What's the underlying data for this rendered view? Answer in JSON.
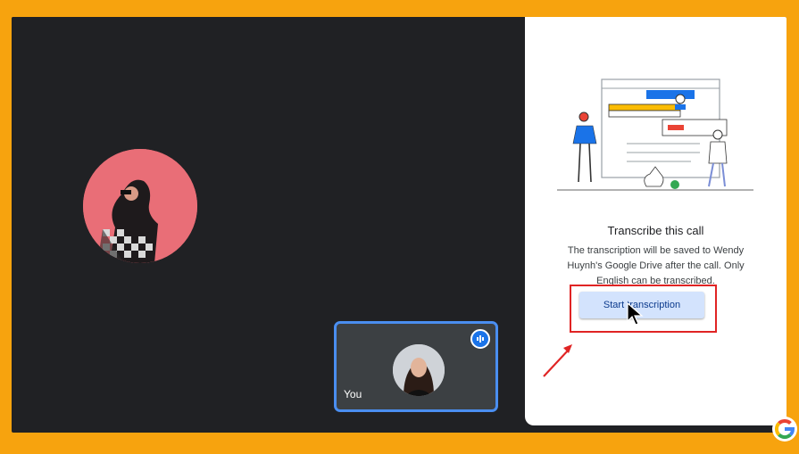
{
  "self_tile": {
    "label": "You"
  },
  "transcribe_panel": {
    "title": "Transcribe this call",
    "description": "The transcription will be saved to Wendy Huynh's Google Drive after the call. Only English can be transcribed.",
    "start_button_label": "Start transcription"
  },
  "colors": {
    "outer_border": "#f7a30e",
    "call_background": "#202124",
    "highlight": "#e02424",
    "button_fill": "#d3e3fd",
    "tile_border": "#4a8ef0"
  },
  "icons": {
    "audio": "audio-level-icon",
    "cursor": "mouse-pointer-icon",
    "annotation": "red-arrow-icon",
    "brand": "google-g-logo"
  }
}
